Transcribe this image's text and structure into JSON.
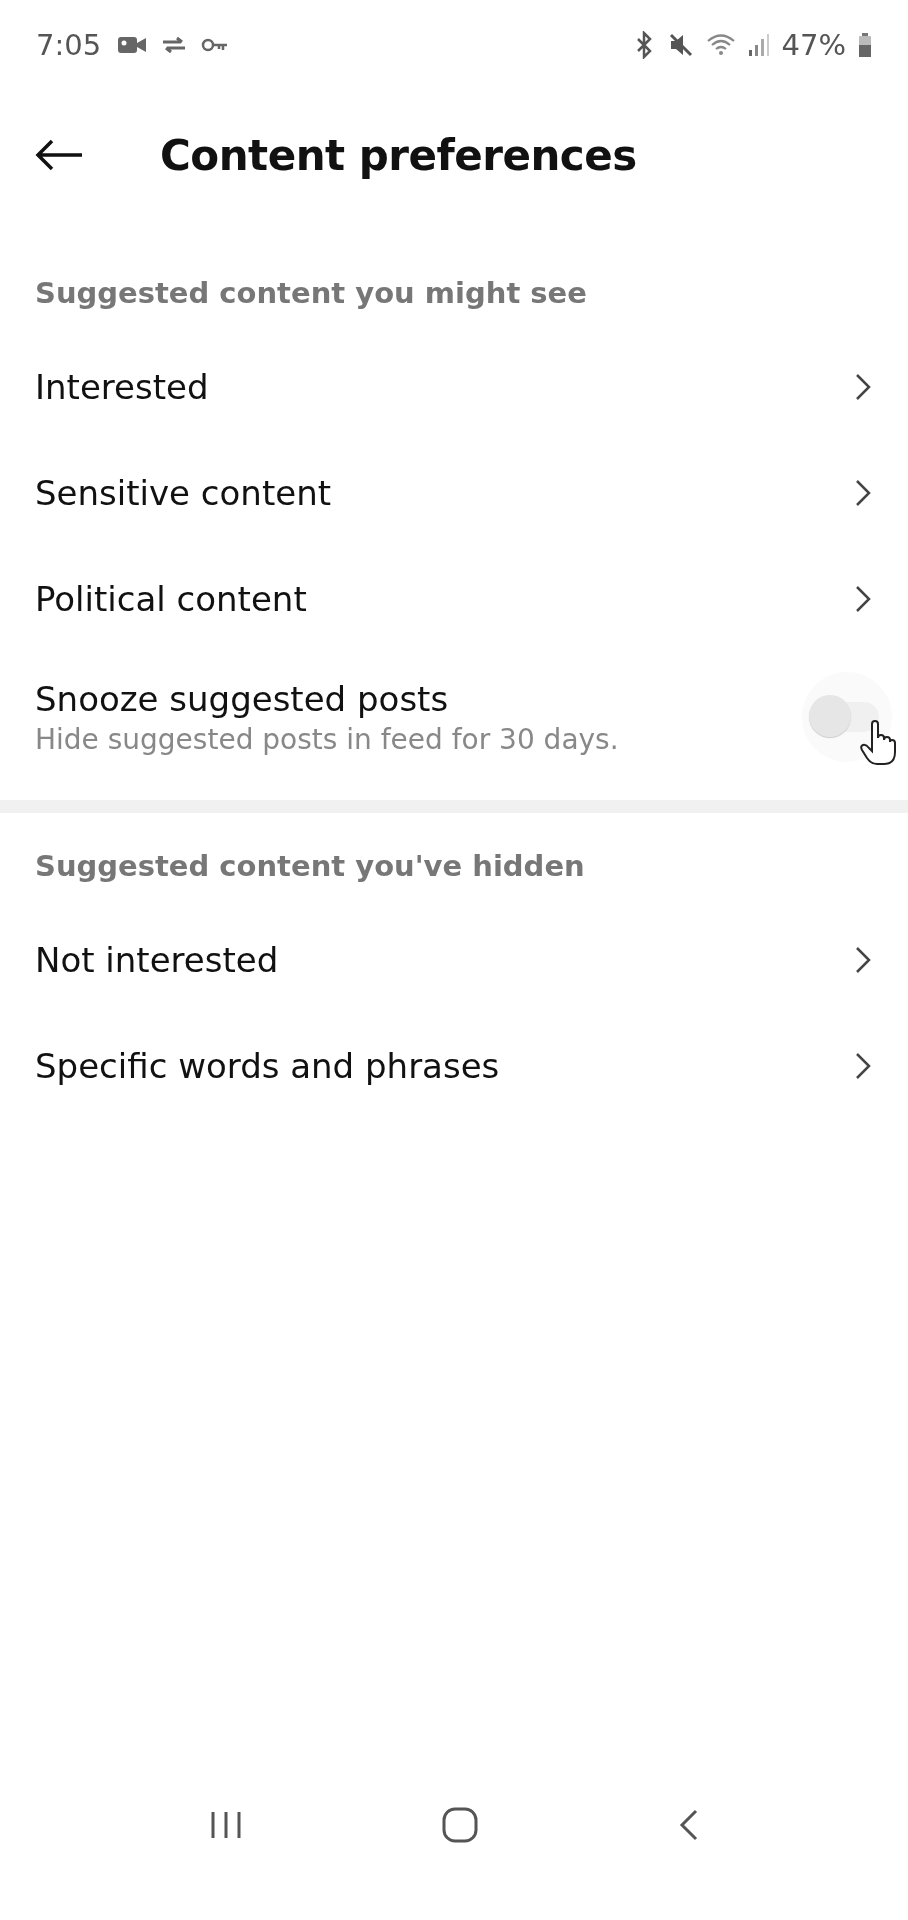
{
  "status_bar": {
    "time": "7:05",
    "battery": "47%"
  },
  "header": {
    "title": "Content preferences"
  },
  "sections": [
    {
      "title": "Suggested content you might see",
      "items": [
        {
          "kind": "link",
          "label": "Interested"
        },
        {
          "kind": "link",
          "label": "Sensitive content"
        },
        {
          "kind": "link",
          "label": "Political content"
        },
        {
          "kind": "toggle",
          "label": "Snooze suggested posts",
          "subtitle": "Hide suggested posts in feed for 30 days.",
          "on": false
        }
      ]
    },
    {
      "title": "Suggested content you've hidden",
      "items": [
        {
          "kind": "link",
          "label": "Not interested"
        },
        {
          "kind": "link",
          "label": "Specific words and phrases"
        }
      ]
    }
  ]
}
